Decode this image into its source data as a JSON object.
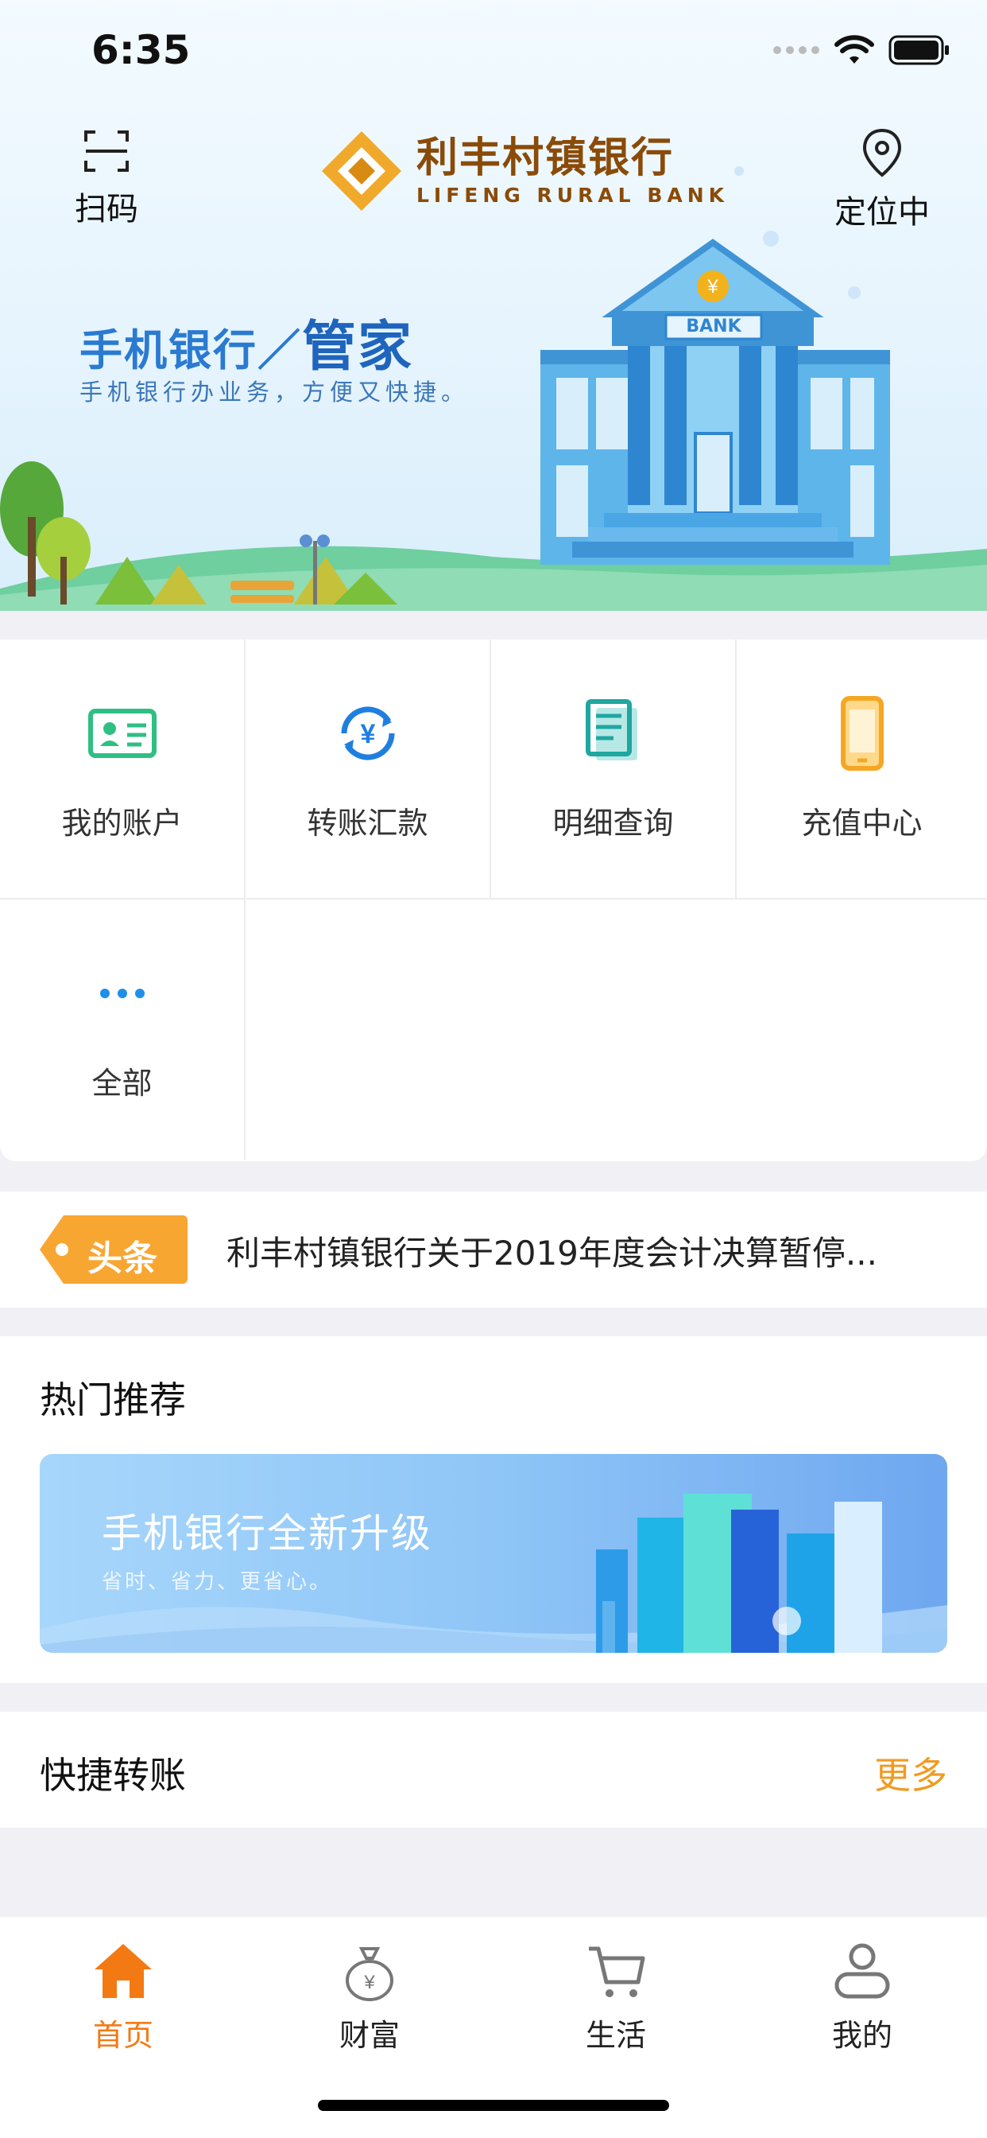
{
  "status": {
    "time": "6:35"
  },
  "header": {
    "scan_label": "扫码",
    "locate_label": "定位中",
    "logo_cn": "利丰村镇银行",
    "logo_en": "LIFENG RURAL BANK"
  },
  "hero": {
    "title_part1": "手机银行／",
    "title_part2": "管家",
    "subtitle": "手机银行办业务，方便又快捷。",
    "bank_sign": "BANK"
  },
  "grid": {
    "items": [
      {
        "label": "我的账户",
        "icon": "account-card-icon"
      },
      {
        "label": "转账汇款",
        "icon": "transfer-icon"
      },
      {
        "label": "明细查询",
        "icon": "statement-icon"
      },
      {
        "label": "充值中心",
        "icon": "phone-topup-icon"
      },
      {
        "label": "全部",
        "icon": "more-dots-icon"
      }
    ]
  },
  "news": {
    "tag": "头条",
    "text": "利丰村镇银行关于2019年度会计决算暂停..."
  },
  "hot": {
    "title": "热门推荐",
    "banner_title": "手机银行全新升级",
    "banner_subtitle": "省时、省力、更省心。"
  },
  "quick": {
    "title": "快捷转账",
    "more": "更多"
  },
  "tabbar": {
    "tabs": [
      {
        "label": "首页"
      },
      {
        "label": "财富"
      },
      {
        "label": "生活"
      },
      {
        "label": "我的"
      }
    ]
  },
  "colors": {
    "accent": "#f37a13",
    "brand_blue": "#1f64bd",
    "more_orange": "#f09a22"
  }
}
